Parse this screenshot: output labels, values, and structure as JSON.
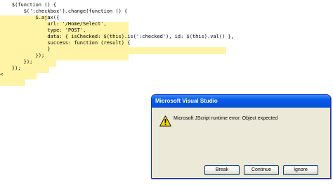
{
  "editor": {
    "lines": [
      "    $(function () {",
      "        $(':checkbox').change(function () {",
      "            $.ajax({",
      "                url: '/Home/Select',",
      "                type: 'POST',",
      "                data: { isChecked: $(this).is(':checked'), id: $(this).val() },",
      "                success: function (result) {",
      "                }",
      "            });",
      "        });",
      "    });",
      "<"
    ],
    "highlight_color": "#fff3a6"
  },
  "dialog": {
    "title": "Microsoft Visual Studio",
    "icon": "warning-icon",
    "message": "Microsoft JScript runtime error: Object expected",
    "buttons": {
      "break_label": "Break",
      "continue_label": "Continue",
      "ignore_label": "Ignore"
    },
    "titlebar_color": "#0a5ce8",
    "body_color": "#ece9d8"
  }
}
